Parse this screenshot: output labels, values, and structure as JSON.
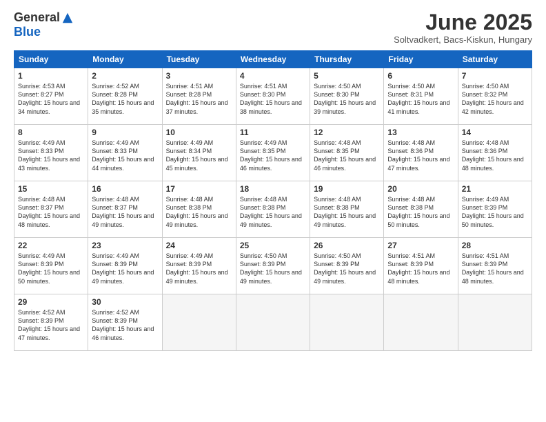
{
  "header": {
    "logo_general": "General",
    "logo_blue": "Blue",
    "month_title": "June 2025",
    "subtitle": "Soltvadkert, Bacs-Kiskun, Hungary"
  },
  "days_of_week": [
    "Sunday",
    "Monday",
    "Tuesday",
    "Wednesday",
    "Thursday",
    "Friday",
    "Saturday"
  ],
  "weeks": [
    [
      {
        "day": 1,
        "sunrise": "4:53 AM",
        "sunset": "8:27 PM",
        "daylight": "15 hours and 34 minutes."
      },
      {
        "day": 2,
        "sunrise": "4:52 AM",
        "sunset": "8:28 PM",
        "daylight": "15 hours and 35 minutes."
      },
      {
        "day": 3,
        "sunrise": "4:51 AM",
        "sunset": "8:28 PM",
        "daylight": "15 hours and 37 minutes."
      },
      {
        "day": 4,
        "sunrise": "4:51 AM",
        "sunset": "8:30 PM",
        "daylight": "15 hours and 38 minutes."
      },
      {
        "day": 5,
        "sunrise": "4:50 AM",
        "sunset": "8:30 PM",
        "daylight": "15 hours and 39 minutes."
      },
      {
        "day": 6,
        "sunrise": "4:50 AM",
        "sunset": "8:31 PM",
        "daylight": "15 hours and 41 minutes."
      },
      {
        "day": 7,
        "sunrise": "4:50 AM",
        "sunset": "8:32 PM",
        "daylight": "15 hours and 42 minutes."
      }
    ],
    [
      {
        "day": 8,
        "sunrise": "4:49 AM",
        "sunset": "8:33 PM",
        "daylight": "15 hours and 43 minutes."
      },
      {
        "day": 9,
        "sunrise": "4:49 AM",
        "sunset": "8:33 PM",
        "daylight": "15 hours and 44 minutes."
      },
      {
        "day": 10,
        "sunrise": "4:49 AM",
        "sunset": "8:34 PM",
        "daylight": "15 hours and 45 minutes."
      },
      {
        "day": 11,
        "sunrise": "4:49 AM",
        "sunset": "8:35 PM",
        "daylight": "15 hours and 46 minutes."
      },
      {
        "day": 12,
        "sunrise": "4:48 AM",
        "sunset": "8:35 PM",
        "daylight": "15 hours and 46 minutes."
      },
      {
        "day": 13,
        "sunrise": "4:48 AM",
        "sunset": "8:36 PM",
        "daylight": "15 hours and 47 minutes."
      },
      {
        "day": 14,
        "sunrise": "4:48 AM",
        "sunset": "8:36 PM",
        "daylight": "15 hours and 48 minutes."
      }
    ],
    [
      {
        "day": 15,
        "sunrise": "4:48 AM",
        "sunset": "8:37 PM",
        "daylight": "15 hours and 48 minutes."
      },
      {
        "day": 16,
        "sunrise": "4:48 AM",
        "sunset": "8:37 PM",
        "daylight": "15 hours and 49 minutes."
      },
      {
        "day": 17,
        "sunrise": "4:48 AM",
        "sunset": "8:38 PM",
        "daylight": "15 hours and 49 minutes."
      },
      {
        "day": 18,
        "sunrise": "4:48 AM",
        "sunset": "8:38 PM",
        "daylight": "15 hours and 49 minutes."
      },
      {
        "day": 19,
        "sunrise": "4:48 AM",
        "sunset": "8:38 PM",
        "daylight": "15 hours and 49 minutes."
      },
      {
        "day": 20,
        "sunrise": "4:48 AM",
        "sunset": "8:38 PM",
        "daylight": "15 hours and 50 minutes."
      },
      {
        "day": 21,
        "sunrise": "4:49 AM",
        "sunset": "8:39 PM",
        "daylight": "15 hours and 50 minutes."
      }
    ],
    [
      {
        "day": 22,
        "sunrise": "4:49 AM",
        "sunset": "8:39 PM",
        "daylight": "15 hours and 50 minutes."
      },
      {
        "day": 23,
        "sunrise": "4:49 AM",
        "sunset": "8:39 PM",
        "daylight": "15 hours and 49 minutes."
      },
      {
        "day": 24,
        "sunrise": "4:49 AM",
        "sunset": "8:39 PM",
        "daylight": "15 hours and 49 minutes."
      },
      {
        "day": 25,
        "sunrise": "4:50 AM",
        "sunset": "8:39 PM",
        "daylight": "15 hours and 49 minutes."
      },
      {
        "day": 26,
        "sunrise": "4:50 AM",
        "sunset": "8:39 PM",
        "daylight": "15 hours and 49 minutes."
      },
      {
        "day": 27,
        "sunrise": "4:51 AM",
        "sunset": "8:39 PM",
        "daylight": "15 hours and 48 minutes."
      },
      {
        "day": 28,
        "sunrise": "4:51 AM",
        "sunset": "8:39 PM",
        "daylight": "15 hours and 48 minutes."
      }
    ],
    [
      {
        "day": 29,
        "sunrise": "4:52 AM",
        "sunset": "8:39 PM",
        "daylight": "15 hours and 47 minutes."
      },
      {
        "day": 30,
        "sunrise": "4:52 AM",
        "sunset": "8:39 PM",
        "daylight": "15 hours and 46 minutes."
      },
      null,
      null,
      null,
      null,
      null
    ]
  ]
}
